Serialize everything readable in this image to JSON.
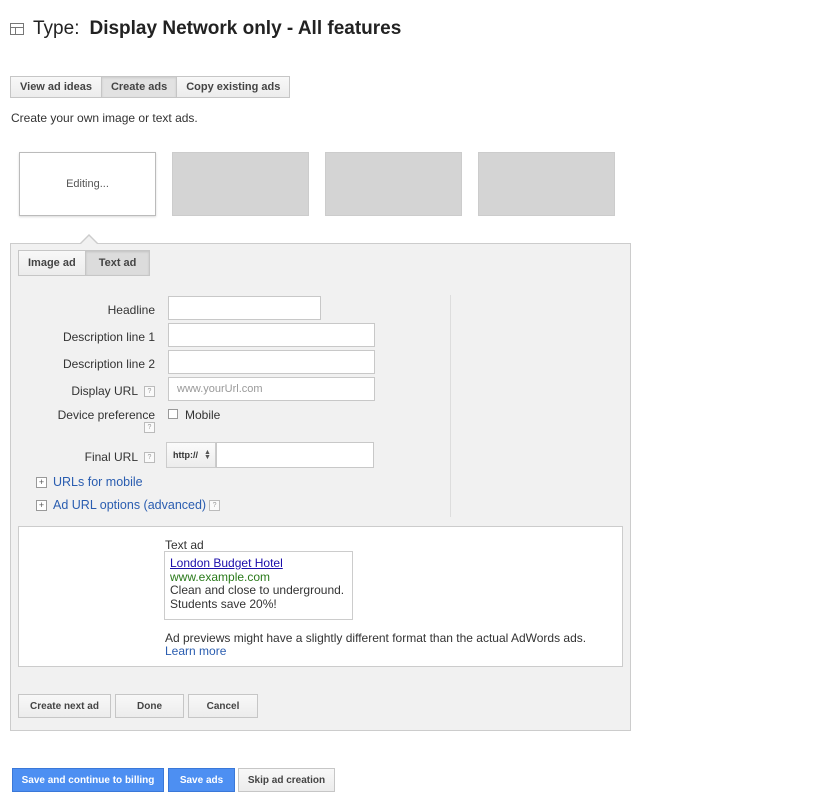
{
  "header": {
    "type_label": "Type:",
    "type_value": "Display Network only - All features"
  },
  "mode_tabs": [
    {
      "label": "View ad ideas"
    },
    {
      "label": "Create ads"
    },
    {
      "label": "Copy existing ads"
    }
  ],
  "intro_text": "Create your own image or text ads.",
  "thumbnails": {
    "editing_label": "Editing..."
  },
  "ad_type_tabs": [
    {
      "label": "Image ad"
    },
    {
      "label": "Text ad"
    }
  ],
  "form": {
    "headline_label": "Headline",
    "desc1_label": "Description line 1",
    "desc2_label": "Description line 2",
    "display_url_label": "Display URL",
    "display_url_placeholder": "www.yourUrl.com",
    "device_pref_label": "Device preference",
    "mobile_label": "Mobile",
    "final_url_label": "Final URL",
    "scheme_value": "http://",
    "urls_for_mobile": "URLs for mobile",
    "ad_url_options": "Ad URL options (advanced)",
    "help_glyph": "?"
  },
  "preview": {
    "title": "Text ad",
    "ad_headline": "London Budget Hotel",
    "ad_url": "www.example.com",
    "ad_line1": "Clean and close to underground.",
    "ad_line2": "Students save 20%!",
    "note": "Ad previews might have a slightly different format than the actual AdWords ads.",
    "learn_more": "Learn more"
  },
  "panel_buttons": {
    "create_next": "Create next ad",
    "done": "Done",
    "cancel": "Cancel"
  },
  "footer_buttons": {
    "save_continue": "Save and continue to billing",
    "save_ads": "Save ads",
    "skip": "Skip ad creation"
  },
  "colors": {
    "link": "#2a5db0",
    "primary_button": "#4d8ff2",
    "ad_url_green": "#2a7a1a"
  }
}
